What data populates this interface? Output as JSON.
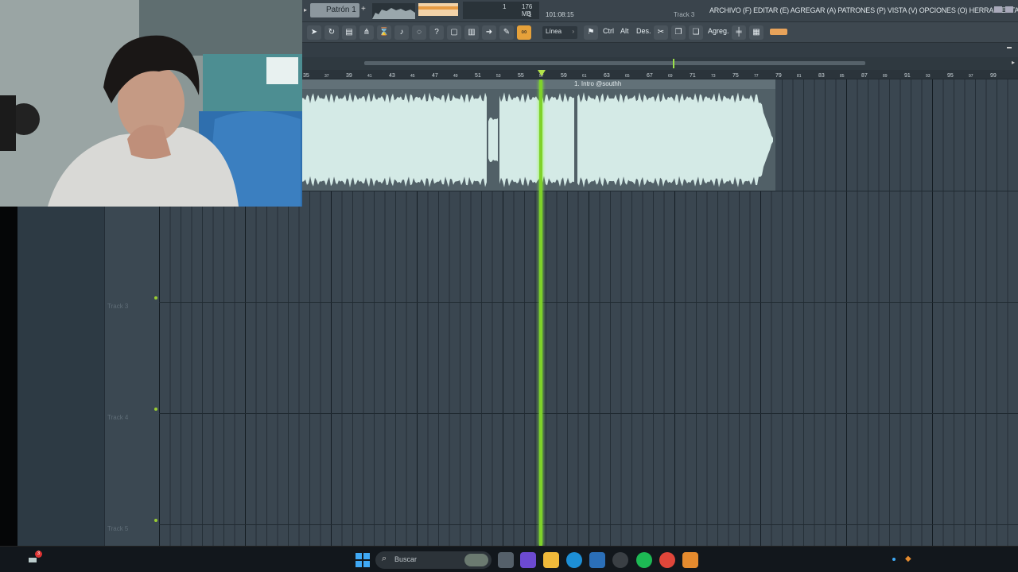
{
  "app": {
    "pattern_label": "Patrón 1",
    "cpu_value": "1",
    "ram": "176 MB",
    "poly_value": "1",
    "time": "101:08:15",
    "hint_track": "Track 3",
    "menu": "ARCHIVO (F) EDITAR (E) AGREGAR (A) PATRONES (P) VISTA (V) OPCIONES (O) HERRAMIENTAS (T) AYUDA"
  },
  "toolbar": {
    "snap_label": "Línea",
    "ctrl_label": "Ctrl",
    "alt_label": "Alt",
    "des_label": "Des.",
    "agreg_label": "Agreg."
  },
  "ruler": {
    "marks": [
      "35",
      "37",
      "39",
      "41",
      "43",
      "45",
      "47",
      "49",
      "51",
      "53",
      "55",
      "57",
      "59",
      "61",
      "63",
      "65",
      "67",
      "69",
      "71",
      "73",
      "75",
      "77",
      "79",
      "81",
      "83",
      "85",
      "87",
      "89",
      "91",
      "93",
      "95",
      "97",
      "99"
    ]
  },
  "clip": {
    "name": "1. Intro @southh"
  },
  "tracks": {
    "labels": [
      "Track 3",
      "Track 4",
      "Track 5"
    ]
  },
  "taskbar": {
    "search_placeholder": "Buscar",
    "notif_count": "3"
  },
  "colors": {
    "playhead": "#7fd12a",
    "waveform": "#d4eae6",
    "clip_bg": "#516067"
  }
}
